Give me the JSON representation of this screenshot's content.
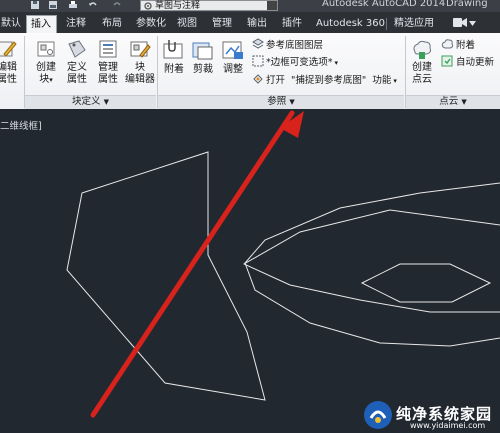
{
  "titlebar": {
    "workspace": "草图与注释",
    "app_title": "Autodesk AutoCAD 2014",
    "doc_title": "Drawing"
  },
  "tabs": [
    {
      "label": "默认"
    },
    {
      "label": "插入"
    },
    {
      "label": "注释"
    },
    {
      "label": "布局"
    },
    {
      "label": "参数化"
    },
    {
      "label": "视图"
    },
    {
      "label": "管理"
    },
    {
      "label": "输出"
    },
    {
      "label": "插件"
    },
    {
      "label": "Autodesk 360"
    },
    {
      "label": "精选应用"
    }
  ],
  "ribbon": {
    "block_panel": {
      "edit_label_1": "编辑",
      "edit_label_2": "属性",
      "create_1": "创建",
      "create_2": "块",
      "define_1": "定义",
      "define_2": "属性",
      "manage_1": "管理",
      "manage_2": "属性",
      "editor_1": "块",
      "editor_2": "编辑器",
      "title": "块定义"
    },
    "reference_panel": {
      "attach": "附着",
      "clip": "剪裁",
      "adjust": "调整",
      "underlay_layers": "参考底图图层",
      "frame_option": "*边框可变选项*",
      "snap_prefix": "打开",
      "snap_option": "\"捕捉到参考底图\"",
      "snap_suffix": "功能",
      "title": "参照"
    },
    "pointcloud_panel": {
      "create_1": "创建",
      "create_2": "点云",
      "attach": "附着",
      "auto_update": "自动更新",
      "title": "点云"
    }
  },
  "viewport": {
    "label": "二维线框]"
  },
  "watermark": {
    "text": "纯净系统家园",
    "url": "www.yidaimei.com"
  },
  "colors": {
    "canvas": "#212830",
    "arrow": "#d8221c",
    "linework": "#e8e8e8"
  }
}
